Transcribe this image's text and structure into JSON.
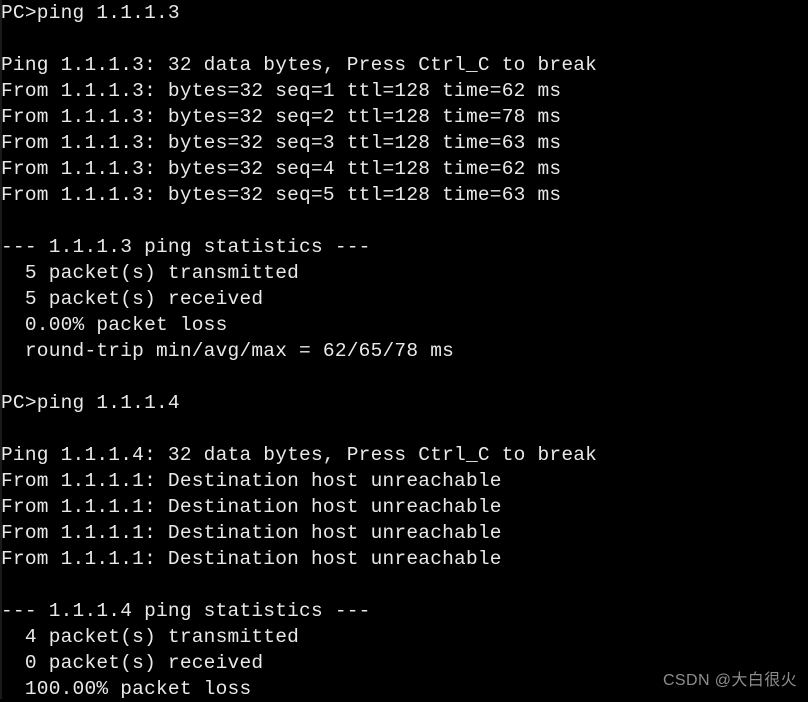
{
  "terminal": {
    "background_color": "#000000",
    "text_color": "#e9e9e9",
    "prompt": "PC>",
    "lines": [
      "PC>ping 1.1.1.3",
      "",
      "Ping 1.1.1.3: 32 data bytes, Press Ctrl_C to break",
      "From 1.1.1.3: bytes=32 seq=1 ttl=128 time=62 ms",
      "From 1.1.1.3: bytes=32 seq=2 ttl=128 time=78 ms",
      "From 1.1.1.3: bytes=32 seq=3 ttl=128 time=63 ms",
      "From 1.1.1.3: bytes=32 seq=4 ttl=128 time=62 ms",
      "From 1.1.1.3: bytes=32 seq=5 ttl=128 time=63 ms",
      "",
      "--- 1.1.1.3 ping statistics ---",
      "  5 packet(s) transmitted",
      "  5 packet(s) received",
      "  0.00% packet loss",
      "  round-trip min/avg/max = 62/65/78 ms",
      "",
      "PC>ping 1.1.1.4",
      "",
      "Ping 1.1.1.4: 32 data bytes, Press Ctrl_C to break",
      "From 1.1.1.1: Destination host unreachable",
      "From 1.1.1.1: Destination host unreachable",
      "From 1.1.1.1: Destination host unreachable",
      "From 1.1.1.1: Destination host unreachable",
      "",
      "--- 1.1.1.4 ping statistics ---",
      "  4 packet(s) transmitted",
      "  0 packet(s) received",
      "  100.00% packet loss"
    ],
    "sessions": [
      {
        "command": "ping 1.1.1.3",
        "target": "1.1.1.3",
        "header": "Ping 1.1.1.3: 32 data bytes, Press Ctrl_C to break",
        "data_bytes": "32",
        "break_hint": "Press Ctrl_C to break",
        "replies": [
          {
            "source": "1.1.1.3",
            "bytes": "32",
            "seq": "1",
            "ttl": "128",
            "time": "62",
            "unit": "ms"
          },
          {
            "source": "1.1.1.3",
            "bytes": "32",
            "seq": "2",
            "ttl": "128",
            "time": "78",
            "unit": "ms"
          },
          {
            "source": "1.1.1.3",
            "bytes": "32",
            "seq": "3",
            "ttl": "128",
            "time": "63",
            "unit": "ms"
          },
          {
            "source": "1.1.1.3",
            "bytes": "32",
            "seq": "4",
            "ttl": "128",
            "time": "62",
            "unit": "ms"
          },
          {
            "source": "1.1.1.3",
            "bytes": "32",
            "seq": "5",
            "ttl": "128",
            "time": "63",
            "unit": "ms"
          }
        ],
        "statistics": {
          "title": "--- 1.1.1.3 ping statistics ---",
          "transmitted": "  5 packet(s) transmitted",
          "received": "  5 packet(s) received",
          "loss": "  0.00% packet loss",
          "round_trip": "  round-trip min/avg/max = 62/65/78 ms",
          "min": "62",
          "avg": "65",
          "max": "78"
        }
      },
      {
        "command": "ping 1.1.1.4",
        "target": "1.1.1.4",
        "header": "Ping 1.1.1.4: 32 data bytes, Press Ctrl_C to break",
        "data_bytes": "32",
        "break_hint": "Press Ctrl_C to break",
        "replies": [
          {
            "source": "1.1.1.1",
            "message": "Destination host unreachable"
          },
          {
            "source": "1.1.1.1",
            "message": "Destination host unreachable"
          },
          {
            "source": "1.1.1.1",
            "message": "Destination host unreachable"
          },
          {
            "source": "1.1.1.1",
            "message": "Destination host unreachable"
          }
        ],
        "statistics": {
          "title": "--- 1.1.1.4 ping statistics ---",
          "transmitted": "  4 packet(s) transmitted",
          "received": "  0 packet(s) received",
          "loss": "  100.00% packet loss"
        }
      }
    ]
  },
  "watermark": {
    "text": "CSDN @大白很火",
    "color": "#8d8d8d"
  }
}
